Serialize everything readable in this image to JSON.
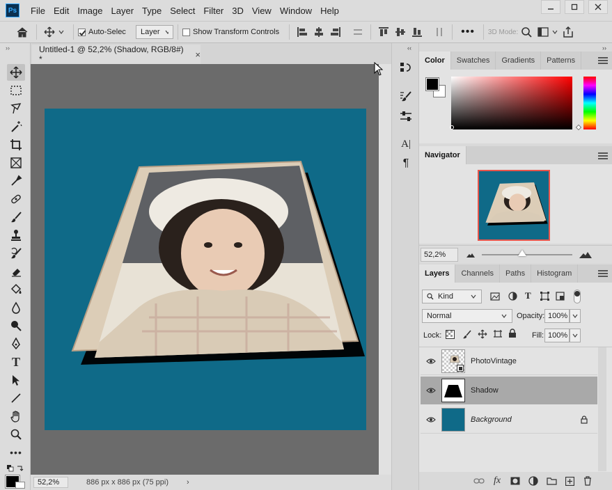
{
  "app": {
    "logo_text": "Ps",
    "menu": [
      "File",
      "Edit",
      "Image",
      "Layer",
      "Type",
      "Select",
      "Filter",
      "3D",
      "View",
      "Window",
      "Help"
    ],
    "window_controls": [
      "minimize-icon",
      "maximize-icon",
      "close-icon"
    ]
  },
  "options_bar": {
    "auto_select_label": "Auto-Select:",
    "auto_select_checked": true,
    "auto_select_target": "Layer",
    "show_transform_label": "Show Transform Controls",
    "show_transform_checked": false,
    "mode_label": "3D Mode:",
    "more_label": "•••"
  },
  "document": {
    "tab_title": "Untitled-1 @ 52,2% (Shadow, RGB/8#) *",
    "close_glyph": "×",
    "canvas_color": "#0f6a88",
    "zoom": "52,2%",
    "doc_info": "886 px x 886 px (75 ppi)",
    "status_arrow": "›"
  },
  "tools": [
    "move-tool",
    "marquee-tool",
    "lasso-tool",
    "magic-wand-tool",
    "crop-tool",
    "frame-tool",
    "eyedropper-tool",
    "healing-brush-tool",
    "brush-tool",
    "clone-stamp-tool",
    "history-brush-tool",
    "eraser-tool",
    "paint-bucket-tool",
    "blur-tool",
    "dodge-tool",
    "pen-tool",
    "type-tool",
    "path-selection-tool",
    "line-tool",
    "hand-tool",
    "zoom-tool",
    "more-tools"
  ],
  "tool_glyphs": {
    "type": "T",
    "more": "•••"
  },
  "collapse_glyph": "‹‹",
  "expand_glyph": "››",
  "color_panel": {
    "tabs": [
      "Color",
      "Swatches",
      "Gradients",
      "Patterns"
    ],
    "active_tab": "Color",
    "foreground": "#000000",
    "background": "#ffffff",
    "hue": "#ff0000"
  },
  "navigator_panel": {
    "title": "Navigator",
    "zoom": "52,2%"
  },
  "layers_panel": {
    "tabs": [
      "Layers",
      "Channels",
      "Paths",
      "Histogram"
    ],
    "active_tab": "Layers",
    "filter_kind": "Kind",
    "blend_mode": "Normal",
    "opacity_label": "Opacity:",
    "opacity": "100%",
    "lock_label": "Lock:",
    "fill_label": "Fill:",
    "fill": "100%",
    "layers": [
      {
        "name": "PhotoVintage",
        "selected": false,
        "locked": false,
        "italic": false
      },
      {
        "name": "Shadow",
        "selected": true,
        "locked": false,
        "italic": false
      },
      {
        "name": "Background",
        "selected": false,
        "locked": true,
        "italic": true
      }
    ],
    "fx_label": "fx"
  },
  "mid_strip": {
    "char_glyph": "A|",
    "para_glyph": "¶"
  }
}
